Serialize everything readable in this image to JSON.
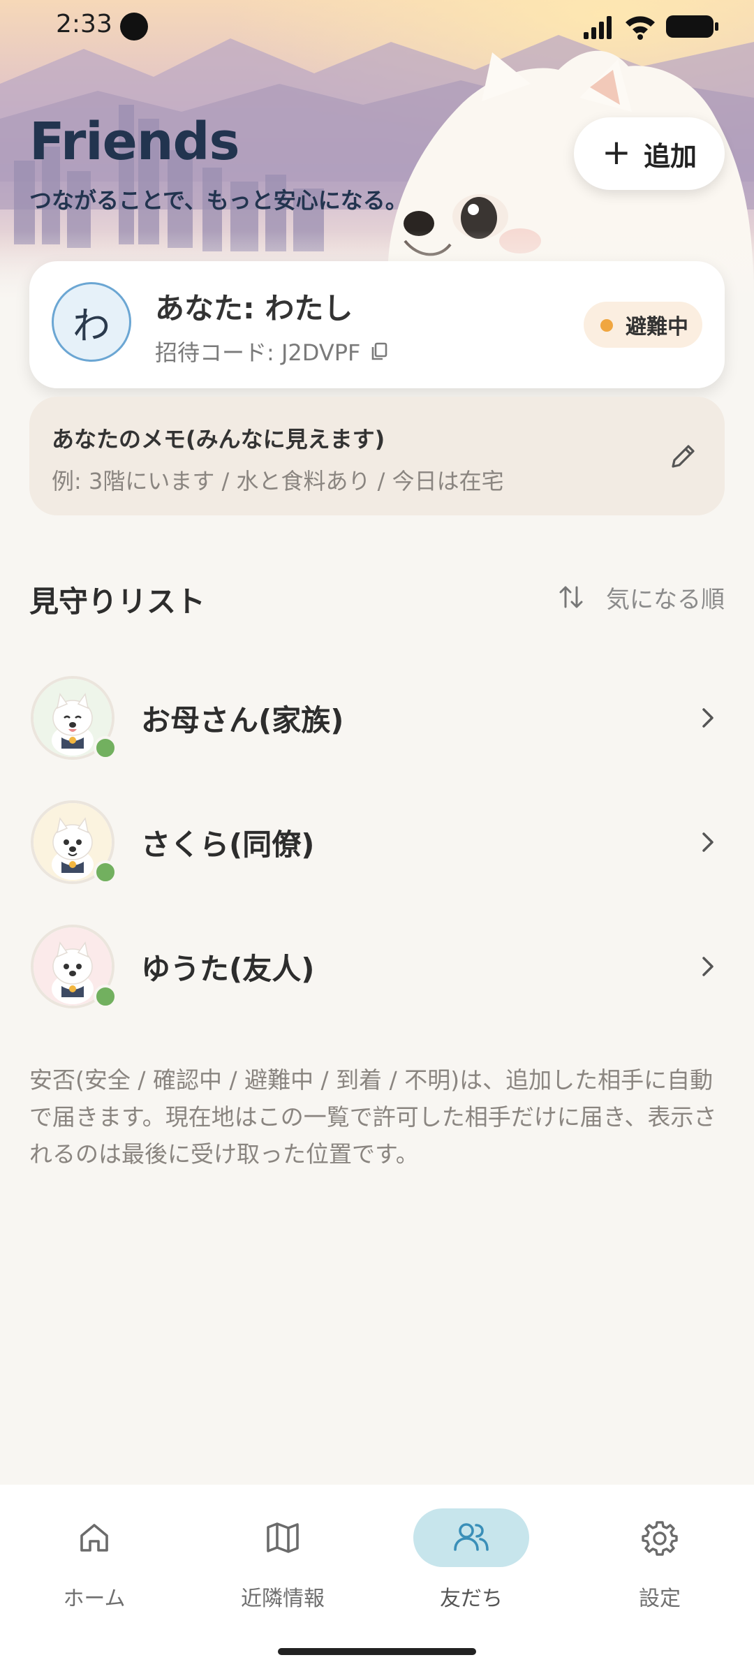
{
  "status_bar": {
    "time": "2:33",
    "icons": [
      "signal-icon",
      "wifi-icon",
      "battery-icon"
    ]
  },
  "header": {
    "title": "Friends",
    "subtitle": "つながることで、もっと安心になる。",
    "add_button": {
      "icon": "plus-icon",
      "label": "追加"
    }
  },
  "profile": {
    "avatar_letter": "わ",
    "name": "あなた: わたし",
    "invite_code": "招待コード: J2DVPF",
    "copy_icon": "copy-icon",
    "status": {
      "label": "避難中",
      "color": "#f0a640"
    }
  },
  "memo": {
    "title": "あなたのメモ(みんなに見えます)",
    "placeholder": "例: 3階にいます / 水と食料あり / 今日は在宅",
    "edit_icon": "pencil-icon"
  },
  "watch_list": {
    "title": "見守りリスト",
    "sort_icon": "sort-arrows-icon",
    "sort_label": "気になる順",
    "friends": [
      {
        "name": "お母さん(家族)",
        "online": true
      },
      {
        "name": "さくら(同僚)",
        "online": true
      },
      {
        "name": "ゆうた(友人)",
        "online": true
      }
    ]
  },
  "footnote": "安否(安全 / 確認中 / 避難中 / 到着 / 不明)は、追加した相手に自動で届きます。現在地はこの一覧で許可した相手だけに届き、表示されるのは最後に受け取った位置です。",
  "bottom_nav": {
    "items": [
      {
        "label": "ホーム",
        "icon": "home-icon",
        "active": false
      },
      {
        "label": "近隣情報",
        "icon": "map-icon",
        "active": false
      },
      {
        "label": "友だち",
        "icon": "people-icon",
        "active": true
      },
      {
        "label": "設定",
        "icon": "gear-icon",
        "active": false
      }
    ]
  },
  "colors": {
    "accent_nav": "#c7e5ec",
    "online": "#72b05f",
    "title": "#22344f",
    "background": "#f8f6f2"
  }
}
